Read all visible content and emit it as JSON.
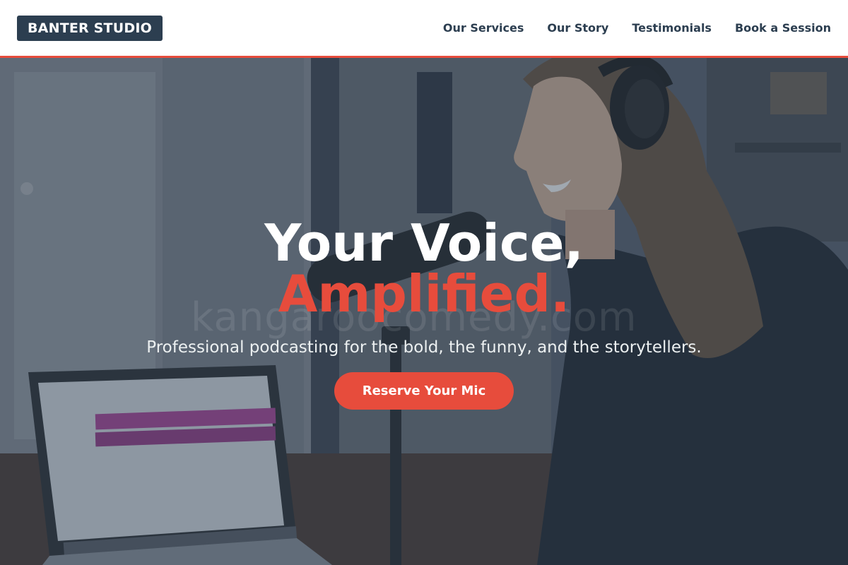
{
  "header": {
    "logo_text": "BANTER STUDIO",
    "nav": [
      {
        "label": "Our Services"
      },
      {
        "label": "Our Story"
      },
      {
        "label": "Testimonials"
      },
      {
        "label": "Book a Session"
      }
    ]
  },
  "hero": {
    "headline": "Your Voice,",
    "headline_accent": "Amplified.",
    "subtext": "Professional podcasting for the bold, the funny, and the storytellers.",
    "cta_label": "Reserve Your Mic",
    "watermark": "kangaroocomedy.com",
    "background_image": "woman-with-headphones-podcast-microphone-laptop"
  },
  "colors": {
    "primary": "#2c3e50",
    "accent": "#e74c3c",
    "white": "#ffffff"
  }
}
